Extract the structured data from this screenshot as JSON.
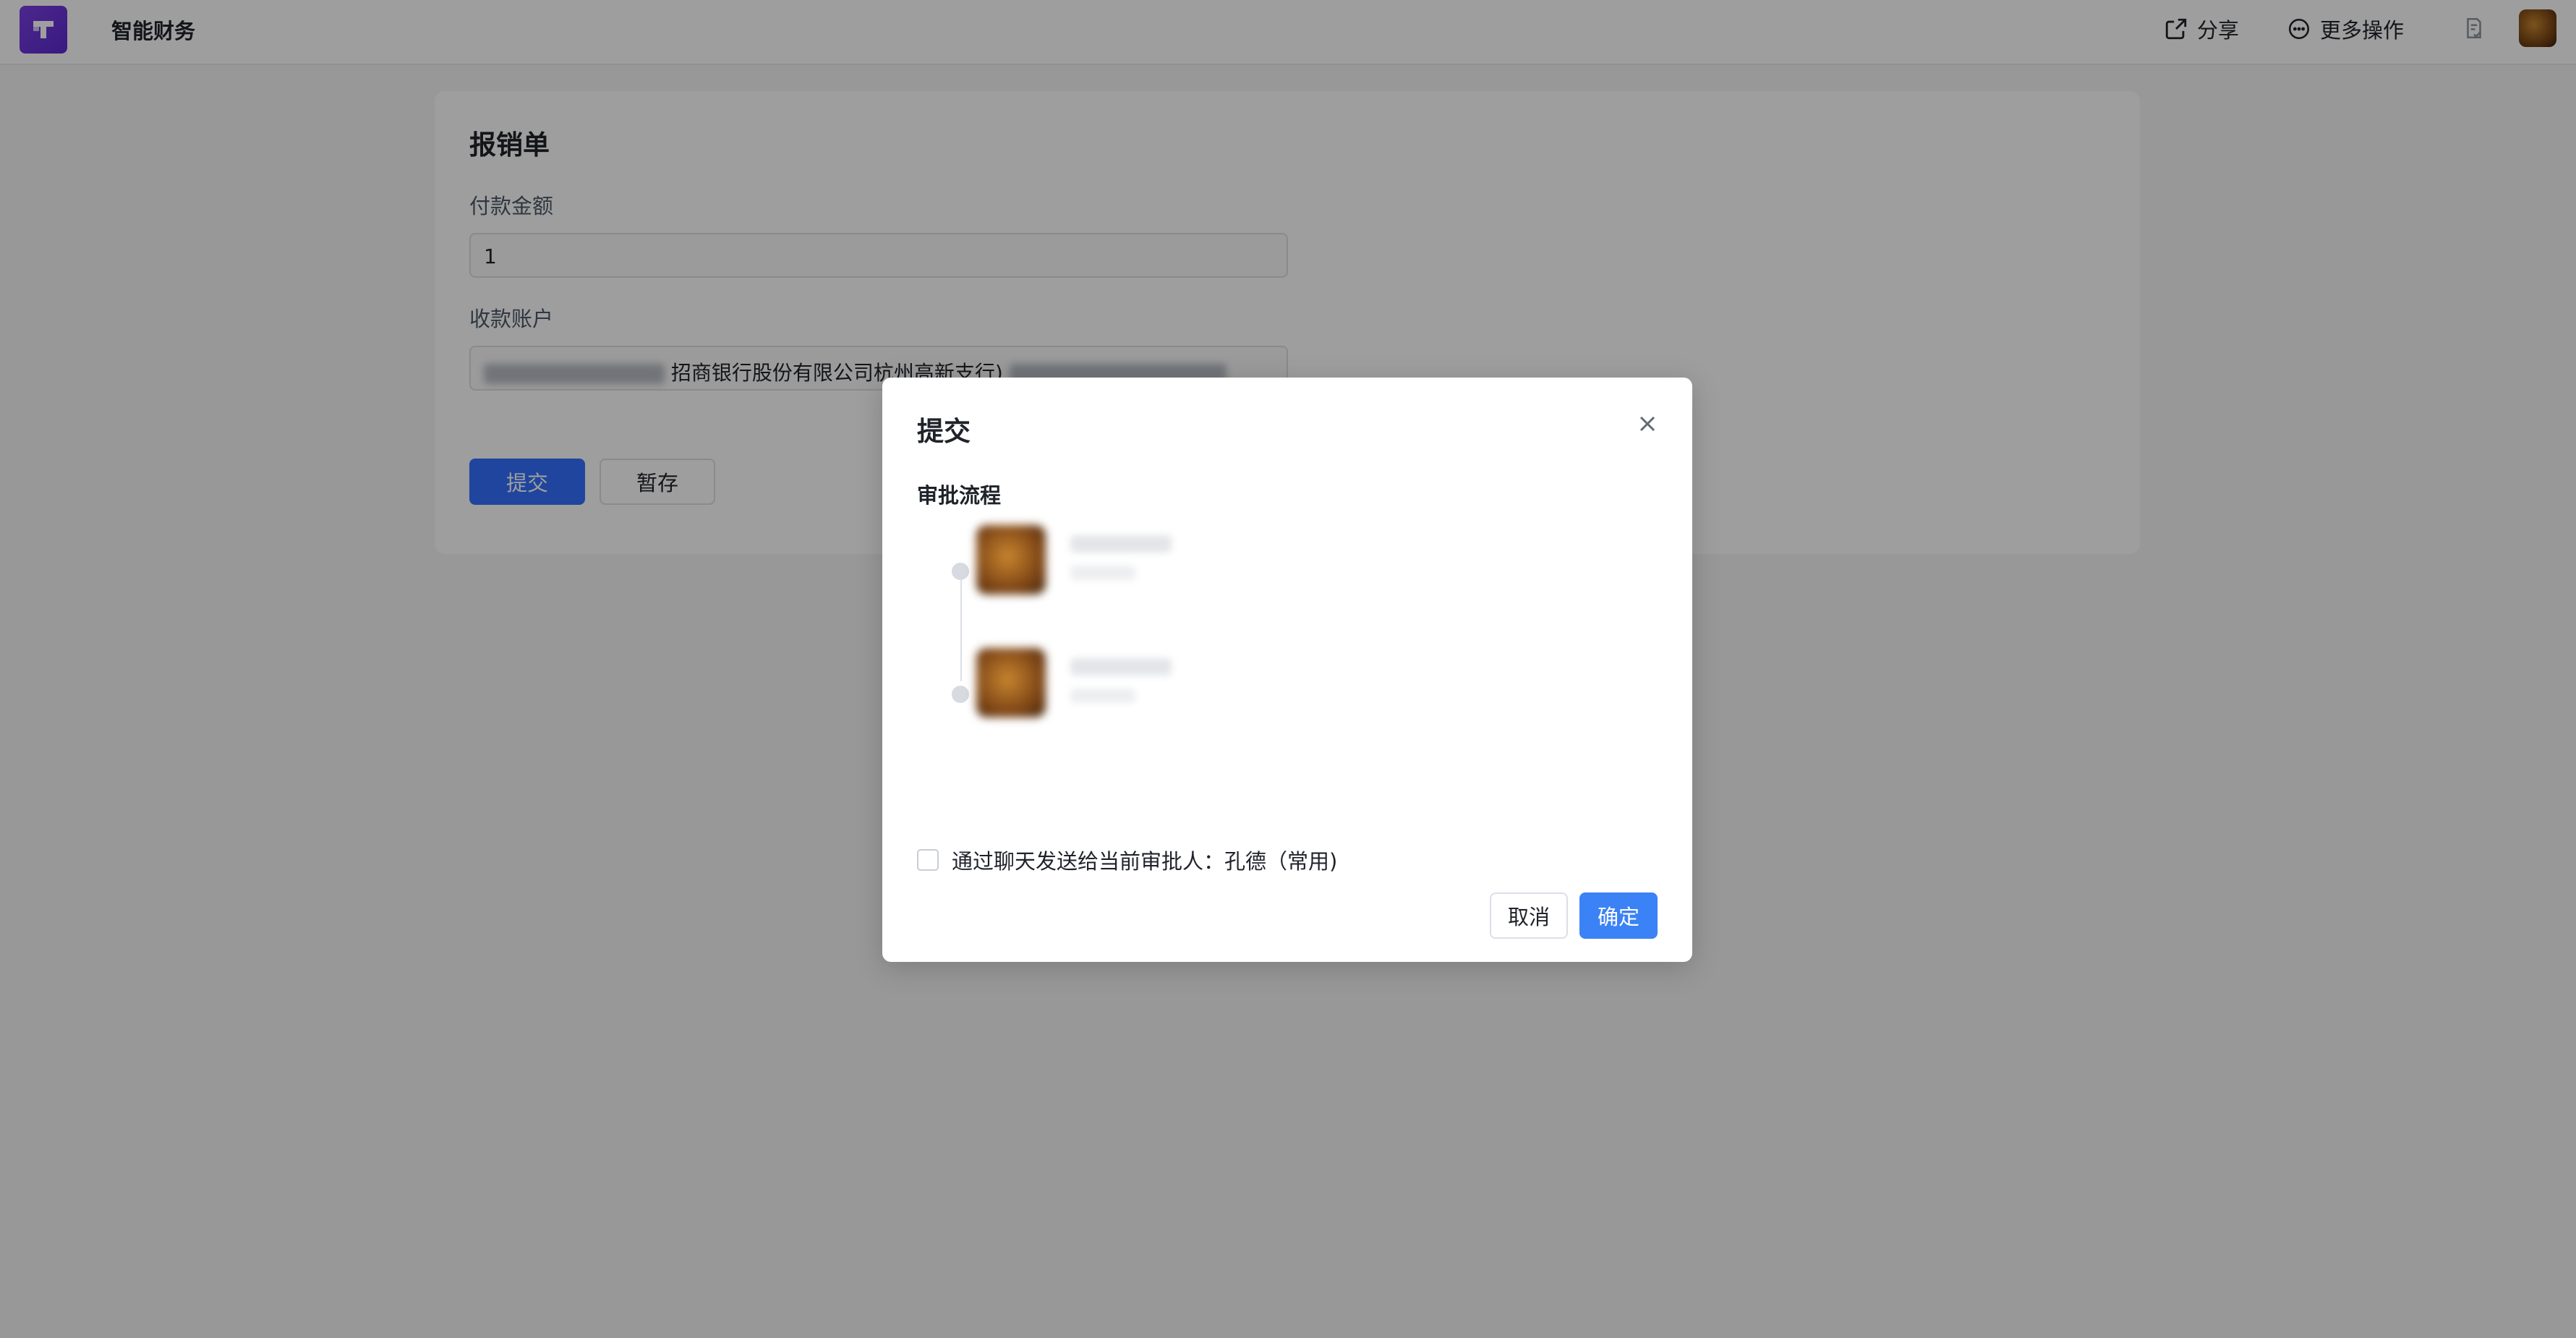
{
  "header": {
    "app_title": "智能财务",
    "share_label": "分享",
    "more_label": "更多操作",
    "logo_icon": "app-logo-icon",
    "share_icon": "external-share-icon",
    "more_icon": "ellipsis-circle-icon",
    "notes_icon": "document-check-icon"
  },
  "form": {
    "title": "报销单",
    "amount_label": "付款金额",
    "amount_value": "1",
    "account_label": "收款账户",
    "account_visible_text": "招商银行股份有限公司杭州高新支行)",
    "submit_label": "提交",
    "draft_label": "暂存"
  },
  "modal": {
    "title": "提交",
    "flow_label": "审批流程",
    "approvers_count": 2,
    "notify_checked": false,
    "notify_text": "通过聊天发送给当前审批人：孔德（常用)",
    "cancel_label": "取消",
    "confirm_label": "确定"
  },
  "colors": {
    "primary": "#3370ff",
    "confirm": "#3b82f6",
    "logo": "#6a35d9"
  }
}
